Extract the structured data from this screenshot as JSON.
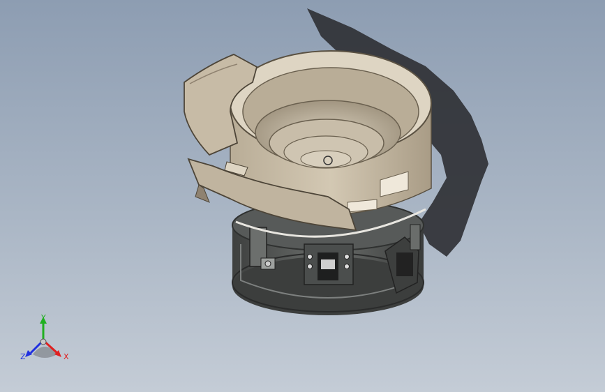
{
  "triad": {
    "y_label": "Y",
    "z_label": "Z",
    "x_label": "X",
    "colors": {
      "x": "#e02020",
      "y": "#20b020",
      "z": "#2030e0"
    }
  },
  "icons": {
    "model": "vibratory-bowl-feeder-model",
    "triad": "coordinate-triad-icon"
  },
  "colors": {
    "bowl": "#c9bda8",
    "bowl_dark": "#8f8270",
    "base": "#5a5d5c",
    "shadow": "#2d2f33"
  }
}
